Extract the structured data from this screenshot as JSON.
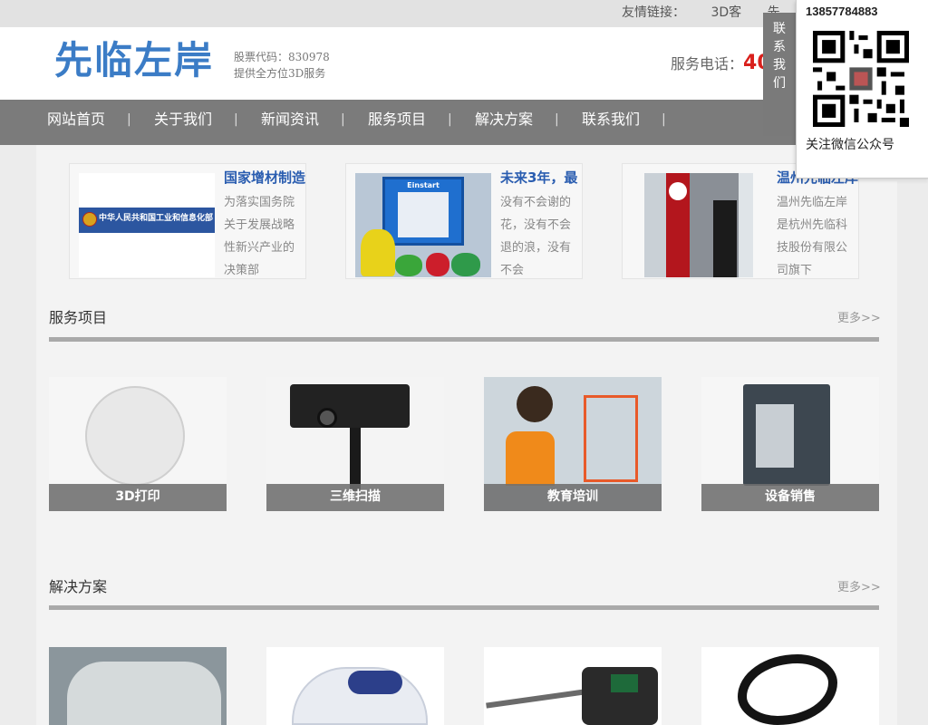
{
  "topbar": {
    "label": "友情链接：",
    "links": [
      "3D客",
      "先"
    ]
  },
  "header": {
    "logo_text": "先临左岸",
    "stock_code": "股票代码：830978",
    "slogan": "提供全方位3D服务",
    "phone_label": "服务电话：",
    "phone_number": "40"
  },
  "nav": {
    "items": [
      "网站首页",
      "关于我们",
      "新闻资讯",
      "服务项目",
      "解决方案",
      "联系我们"
    ],
    "separator": "|"
  },
  "news_cards": [
    {
      "title": "国家增材制造",
      "desc": "为落实国务院关于发展战略性新兴产业的决策部",
      "image": "miit-emblem-banner",
      "banner_text": "中华人民共和国工业和信息化部"
    },
    {
      "title": "未来3年，最",
      "desc": "没有不会谢的花，没有不会退的浪，没有不会",
      "image": "3d-printer-photo",
      "printer_brand": "Einstart"
    },
    {
      "title": "温州先临左岸",
      "desc": "温州先临左岸是杭州先临科技股份有限公司旗下",
      "image": "store-sign-photo"
    }
  ],
  "services": {
    "title": "服务项目",
    "more": "更多>>",
    "items": [
      {
        "caption": "3D打印",
        "image": "printed-sphere-photo"
      },
      {
        "caption": "三维扫描",
        "image": "scanner-on-tripod-photo"
      },
      {
        "caption": "教育培训",
        "image": "child-with-printer-photo"
      },
      {
        "caption": "设备销售",
        "image": "industrial-printer-photo"
      }
    ]
  },
  "solutions": {
    "title": "解决方案",
    "more": "更多>>",
    "items": [
      {
        "image": "car-part-model-photo"
      },
      {
        "image": "vacuum-cleaner-photo"
      },
      {
        "image": "power-drill-photo"
      },
      {
        "image": "abstract-sculpture-photo"
      }
    ]
  },
  "contact_widget": {
    "tab_text": [
      "联",
      "系",
      "我",
      "们"
    ],
    "phone": "13857784883",
    "follow_text": "关注微信公众号"
  },
  "colors": {
    "nav_bg": "#7b7b7b",
    "logo_blue": "#3b7cc6",
    "phone_red": "#d9201c",
    "title_blue": "#2a5db0"
  }
}
